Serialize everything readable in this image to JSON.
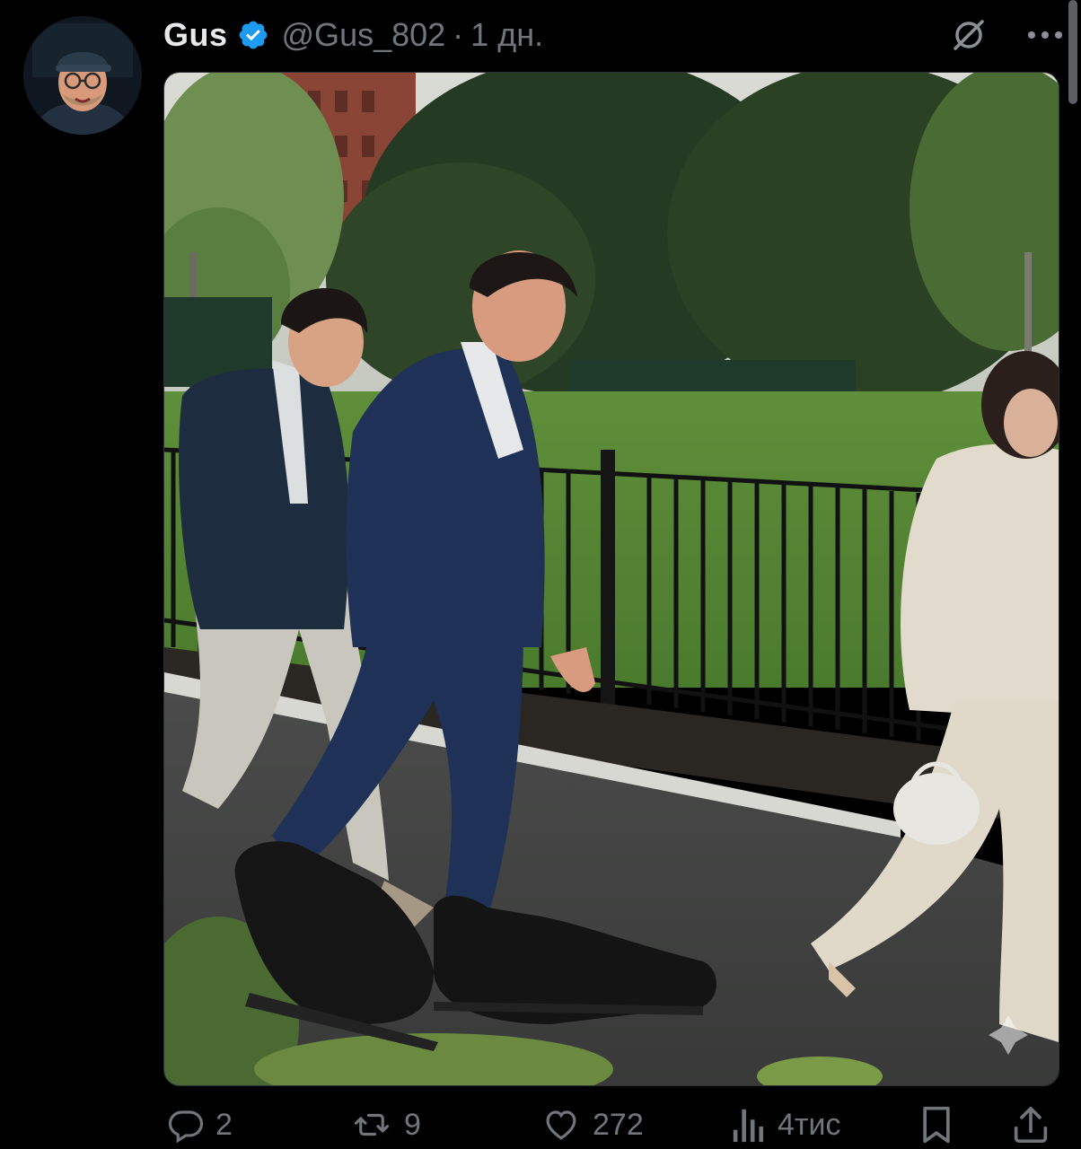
{
  "tweet": {
    "display_name": "Gus",
    "handle": "@Gus_802",
    "separator": "·",
    "time": "1 дн.",
    "verified": true,
    "avatar_icon": "user-avatar",
    "header_icons": [
      "grok-slash-icon",
      "more-options-icon"
    ]
  },
  "actions": {
    "reply": {
      "icon": "reply-icon",
      "count": "2"
    },
    "retweet": {
      "icon": "retweet-icon",
      "count": "9"
    },
    "like": {
      "icon": "heart-icon",
      "count": "272"
    },
    "views": {
      "icon": "views-chart-icon",
      "count": "4тис"
    },
    "bookmark": {
      "icon": "bookmark-icon"
    },
    "share": {
      "icon": "share-icon"
    }
  },
  "colors": {
    "background": "#000000",
    "text_primary": "#e7e9ea",
    "text_secondary": "#71767b",
    "verified_blue": "#1d9bf0"
  }
}
